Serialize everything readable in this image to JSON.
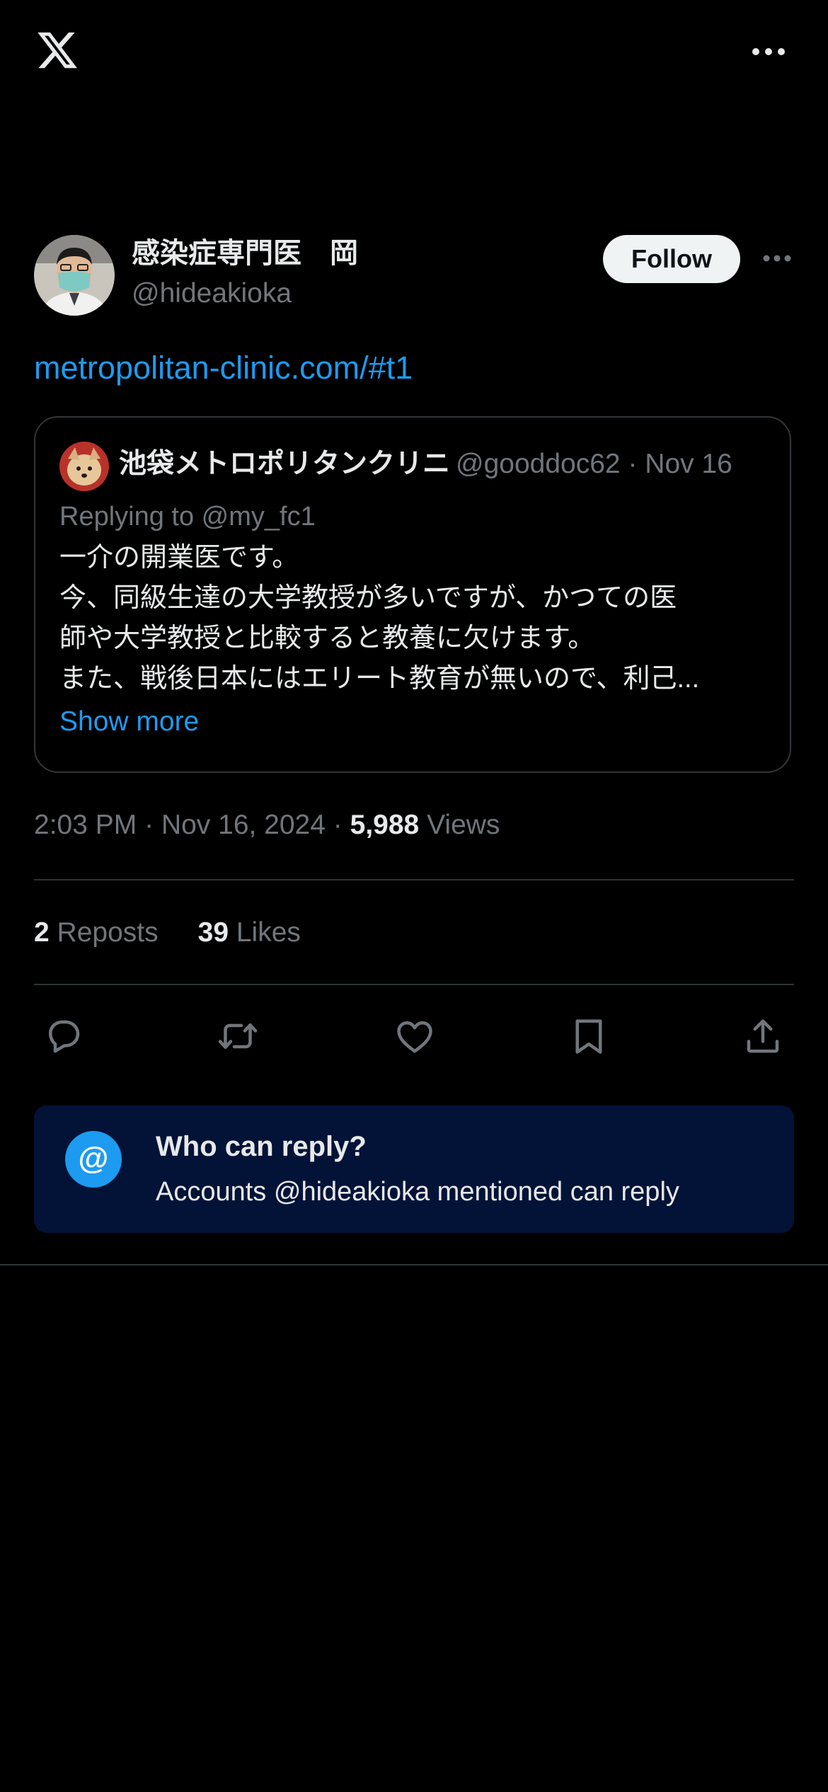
{
  "app": {
    "logo_icon": "x-logo-icon",
    "more_icon": "more-horizontal-icon"
  },
  "author": {
    "display_name": "感染症専門医　岡",
    "handle": "@hideakioka",
    "follow_label": "Follow"
  },
  "tweet": {
    "link_text": "metropolitan-clinic.com/#t1",
    "time": "2:03 PM",
    "date": "Nov 16, 2024",
    "views_count": "5,988",
    "views_label": "Views",
    "separator": "·"
  },
  "quote": {
    "display_name": "池袋メトロポリタンクリニ",
    "handle": "@gooddoc62",
    "date": "Nov 16",
    "handle_date": "@gooddoc62 · Nov 16",
    "replying_to": "Replying to @my_fc1",
    "text_lines": [
      "一介の開業医です。",
      "今、同級生達の大学教授が多いですが、かつての医",
      "師や大学教授と比較すると教養に欠けます。",
      "また、戦後日本にはエリート教育が無いので、利己..."
    ],
    "show_more": "Show more"
  },
  "stats": {
    "reposts_count": "2",
    "reposts_label": "Reposts",
    "likes_count": "39",
    "likes_label": "Likes"
  },
  "actions": [
    {
      "name": "reply",
      "icon": "reply-icon"
    },
    {
      "name": "repost",
      "icon": "repost-icon"
    },
    {
      "name": "like",
      "icon": "heart-icon"
    },
    {
      "name": "bookmark",
      "icon": "bookmark-icon"
    },
    {
      "name": "share",
      "icon": "share-icon"
    }
  ],
  "reply_notice": {
    "icon_glyph": "@",
    "title": "Who can reply?",
    "description": "Accounts @hideakioka mentioned can reply"
  },
  "colors": {
    "background": "#000000",
    "text_primary": "#e7e9ea",
    "text_secondary": "#71767b",
    "accent": "#1d9bf0",
    "divider": "#2f3336",
    "reply_box_bg": "#031337",
    "follow_bg": "#eff3f4"
  }
}
